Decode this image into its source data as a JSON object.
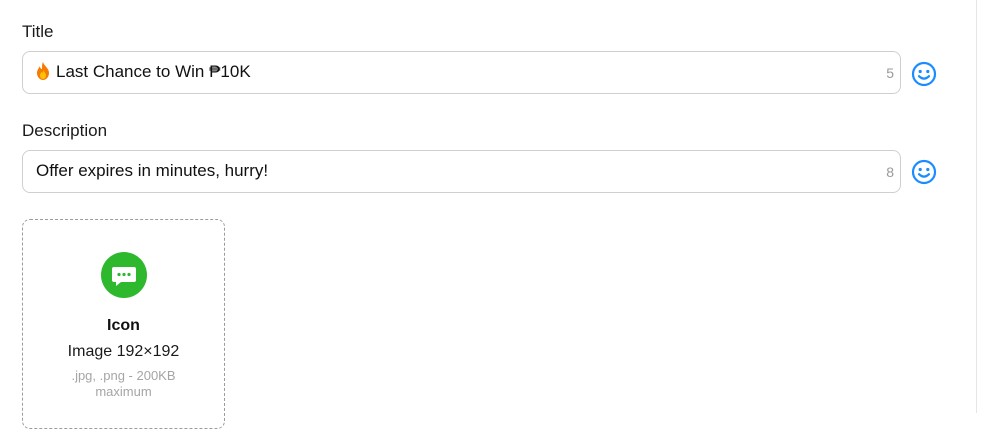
{
  "title_field": {
    "label": "Title",
    "value": "Last Chance to Win ₱10K",
    "count": "5"
  },
  "description_field": {
    "label": "Description",
    "value": "Offer expires in minutes, hurry!",
    "count": "8"
  },
  "icon_upload": {
    "title": "Icon",
    "dimensions": "Image 192×192",
    "hint": ".jpg, .png - 200KB maximum"
  },
  "colors": {
    "accent": "#1a8cff",
    "icon_green": "#2eb82e",
    "border": "#cfcfcf"
  },
  "icons": {
    "emoji": "smiley-face-icon",
    "flame": "fire-emoji-icon",
    "upload": "chat-bubble-icon"
  }
}
